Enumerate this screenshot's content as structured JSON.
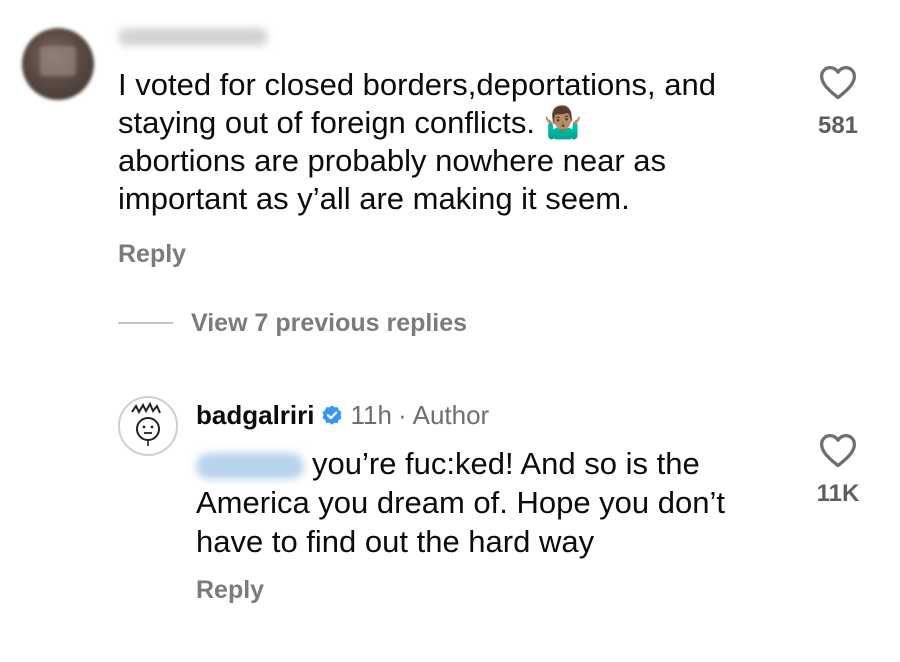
{
  "comment": {
    "lines": [
      "I voted for closed borders,deportations, and",
      "staying out of foreign conflicts.",
      "abortions are probably nowhere near as",
      "important as y’all are making it seem."
    ],
    "emoji": "🤷🏽‍♂️",
    "reply_label": "Reply",
    "likes": "581",
    "heart_icon": "heart-outline"
  },
  "view_replies": "View 7 previous replies",
  "reply": {
    "username": "badgalriri",
    "verified_icon": "verified-badge",
    "verified_color": "#3897f0",
    "time": "11h",
    "separator": "·",
    "author_label": "Author",
    "lines": [
      "you’re fuc:ked! And so is the",
      "America you dream of. Hope you don’t",
      "have to find out the hard way"
    ],
    "reply_label": "Reply",
    "likes": "11K",
    "heart_icon": "heart-outline"
  }
}
